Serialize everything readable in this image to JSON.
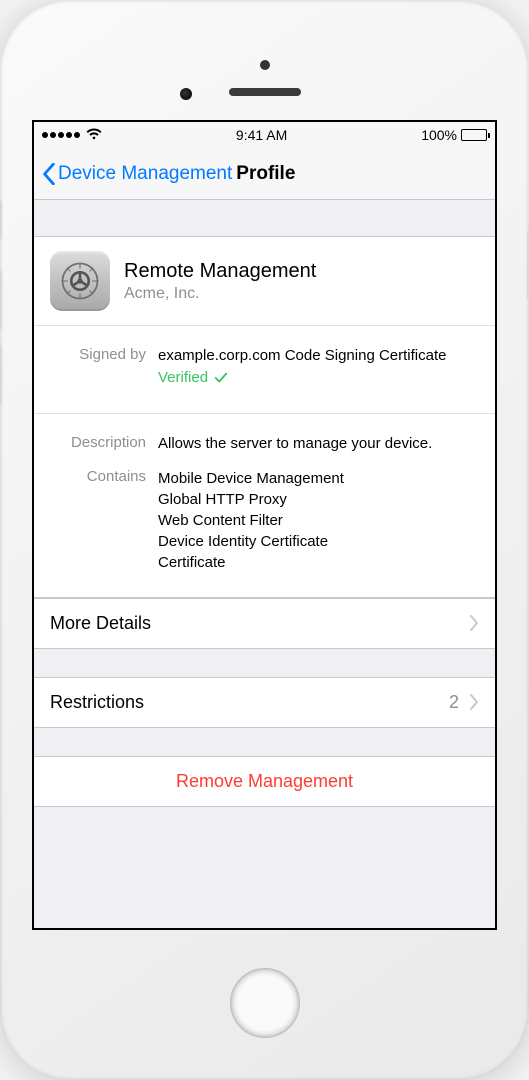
{
  "status": {
    "time": "9:41 AM",
    "battery_pct": "100%"
  },
  "nav": {
    "back_label": "Device Management",
    "title": "Profile"
  },
  "profile": {
    "title": "Remote Management",
    "org": "Acme, Inc.",
    "signed_by_label": "Signed by",
    "signed_by_value": "example.corp.com Code Signing Certificate",
    "verified_label": "Verified",
    "description_label": "Description",
    "description_value": "Allows the server to manage your device.",
    "contains_label": "Contains",
    "contains": [
      "Mobile Device Management",
      "Global HTTP Proxy",
      "Web Content Filter",
      "Device Identity Certificate",
      "Certificate"
    ]
  },
  "rows": {
    "more_details": "More Details",
    "restrictions_label": "Restrictions",
    "restrictions_count": "2",
    "remove": "Remove Management"
  }
}
